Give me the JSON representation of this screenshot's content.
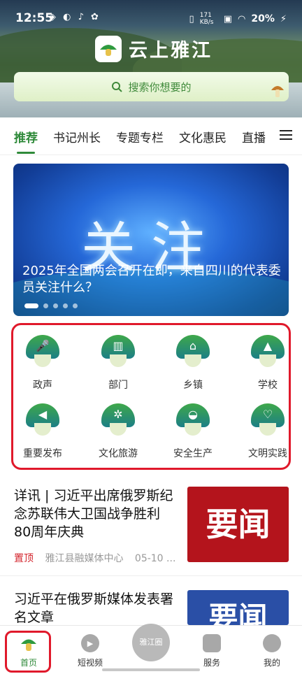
{
  "status": {
    "time": "12:55",
    "net_speed": "171 KB/s",
    "battery": "20%"
  },
  "app": {
    "title": "云上雅江"
  },
  "search": {
    "placeholder": "搜索你想要的"
  },
  "tabs": [
    {
      "label": "推荐",
      "active": true
    },
    {
      "label": "书记州长"
    },
    {
      "label": "专题专栏"
    },
    {
      "label": "文化惠民"
    },
    {
      "label": "直播"
    }
  ],
  "banner": {
    "big_text": "关注",
    "caption": "2025年全国两会召开在即，来自四川的代表委员关注什么？",
    "slides": 5,
    "active_slide": 1
  },
  "categories": [
    {
      "label": "政声",
      "icon": "microphone-icon"
    },
    {
      "label": "部门",
      "icon": "building-icon"
    },
    {
      "label": "乡镇",
      "icon": "house-icon"
    },
    {
      "label": "学校",
      "icon": "graduation-cap-icon"
    },
    {
      "label": "重要发布",
      "icon": "megaphone-icon"
    },
    {
      "label": "文化旅游",
      "icon": "palm-tree-icon"
    },
    {
      "label": "安全生产",
      "icon": "safety-helmet-icon"
    },
    {
      "label": "文明实践",
      "icon": "heart-icon"
    }
  ],
  "news": [
    {
      "title": "详讯 | 习近平出席俄罗斯纪念苏联伟大卫国战争胜利80周年庆典",
      "pin": "置顶",
      "source": "雅江县融媒体中心",
      "date": "05-10 ...",
      "thumb_text": "要闻"
    },
    {
      "title": "习近平在俄罗斯媒体发表署名文章",
      "thumb_text": "要闻"
    }
  ],
  "bottom_nav": [
    {
      "label": "首页",
      "icon": "home-mushroom-icon",
      "active": true
    },
    {
      "label": "短视频",
      "icon": "play-icon"
    },
    {
      "label": "雅江圈",
      "icon": "circle-icon"
    },
    {
      "label": "服务",
      "icon": "grid-icon"
    },
    {
      "label": "我的",
      "icon": "profile-icon"
    }
  ],
  "colors": {
    "accent": "#2f8a3a",
    "highlight": "#e0192b",
    "news_thumb": "#b4141c"
  }
}
